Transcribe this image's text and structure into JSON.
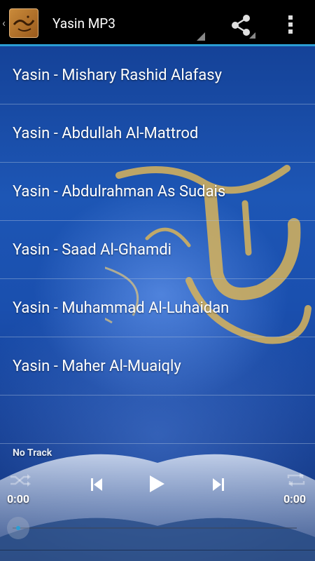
{
  "header": {
    "title": "Yasin MP3",
    "app_icon": "yasin-calligraphy-icon",
    "share_icon": "share-icon",
    "overflow_icon": "more-vert-icon",
    "accent_color": "#2b9ed4"
  },
  "tracks": [
    {
      "label": "Yasin - Mishary Rashid Alafasy"
    },
    {
      "label": "Yasin - Abdullah Al-Mattrod"
    },
    {
      "label": "Yasin - Abdulrahman As Sudais"
    },
    {
      "label": "Yasin - Saad Al-Ghamdi"
    },
    {
      "label": "Yasin - Muhammad Al-Luhaidan"
    },
    {
      "label": "Yasin - Maher Al-Muaiqly"
    }
  ],
  "player": {
    "now_playing": "No Track",
    "elapsed": "0:00",
    "duration": "0:00",
    "progress": 0,
    "controls": [
      "shuffle-icon",
      "previous-icon",
      "play-icon",
      "next-icon",
      "repeat-icon"
    ]
  }
}
